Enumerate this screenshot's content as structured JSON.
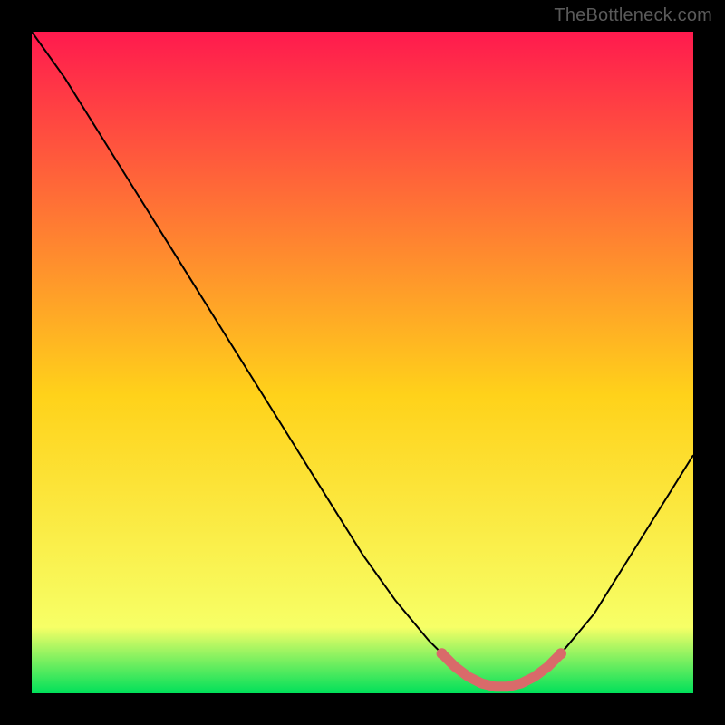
{
  "attribution": "TheBottleneck.com",
  "colors": {
    "frame": "#000000",
    "curve": "#000000",
    "marker": "#d96a6a",
    "gradient_top": "#ff1a4e",
    "gradient_mid": "#ffd21a",
    "gradient_band": "#f7ff66",
    "gradient_bottom": "#00e05a"
  },
  "chart_data": {
    "type": "line",
    "title": "",
    "xlabel": "",
    "ylabel": "",
    "xlim": [
      0,
      100
    ],
    "ylim": [
      0,
      100
    ],
    "background": "vertical-gradient",
    "series": [
      {
        "name": "bottleneck-curve",
        "x": [
          0,
          5,
          10,
          15,
          20,
          25,
          30,
          35,
          40,
          45,
          50,
          55,
          60,
          62,
          64,
          66,
          68,
          70,
          72,
          74,
          76,
          78,
          80,
          85,
          90,
          95,
          100
        ],
        "y": [
          100,
          93,
          85,
          77,
          69,
          61,
          53,
          45,
          37,
          29,
          21,
          14,
          8,
          6,
          4,
          2.5,
          1.5,
          1,
          1,
          1.5,
          2.5,
          4,
          6,
          12,
          20,
          28,
          36
        ]
      }
    ],
    "markers": {
      "name": "optimal-range",
      "x": [
        62,
        64,
        66,
        68,
        70,
        72,
        74,
        76,
        78,
        80
      ],
      "y": [
        6,
        4,
        2.5,
        1.5,
        1,
        1,
        1.5,
        2.5,
        4,
        6
      ]
    }
  }
}
